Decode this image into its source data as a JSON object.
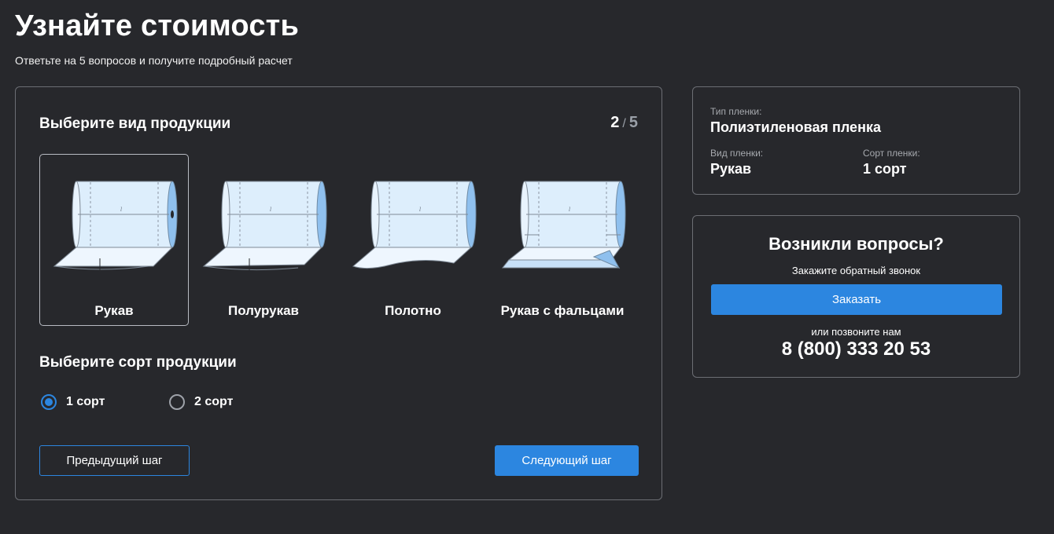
{
  "header": {
    "title": "Узнайте стоимость",
    "subtitle": "Ответьте на 5 вопросов и получите подробный расчет"
  },
  "quiz": {
    "question": "Выберите вид продукции",
    "step_current": "2",
    "step_separator": "/",
    "step_total": "5",
    "products": [
      {
        "label": "Рукав",
        "selected": true,
        "icon": "tube-roll-icon"
      },
      {
        "label": "Полурукав",
        "selected": false,
        "icon": "half-tube-roll-icon"
      },
      {
        "label": "Полотно",
        "selected": false,
        "icon": "sheet-roll-icon"
      },
      {
        "label": "Рукав с фальцами",
        "selected": false,
        "icon": "gusseted-tube-roll-icon"
      }
    ],
    "grade_question": "Выберите сорт продукции",
    "grades": [
      {
        "label": "1 сорт",
        "checked": true
      },
      {
        "label": "2 сорт",
        "checked": false
      }
    ],
    "prev_label": "Предыдущий шаг",
    "next_label": "Следующий шаг"
  },
  "summary": {
    "film_type_caption": "Тип пленки:",
    "film_type_value": "Полиэтиленовая пленка",
    "film_kind_caption": "Вид пленки:",
    "film_kind_value": "Рукав",
    "film_grade_caption": "Сорт пленки:",
    "film_grade_value": "1 сорт"
  },
  "contact": {
    "title": "Возникли вопросы?",
    "subtitle": "Закажите обратный звонок",
    "order_label": "Заказать",
    "call_text": "или позвоните нам",
    "phone": "8 (800) 333 20 53"
  },
  "colors": {
    "background": "#27282c",
    "accent": "#2c86e0",
    "border": "#6c6e74",
    "roll_fill": "#ddeefc",
    "roll_end": "#8fc0ee"
  }
}
